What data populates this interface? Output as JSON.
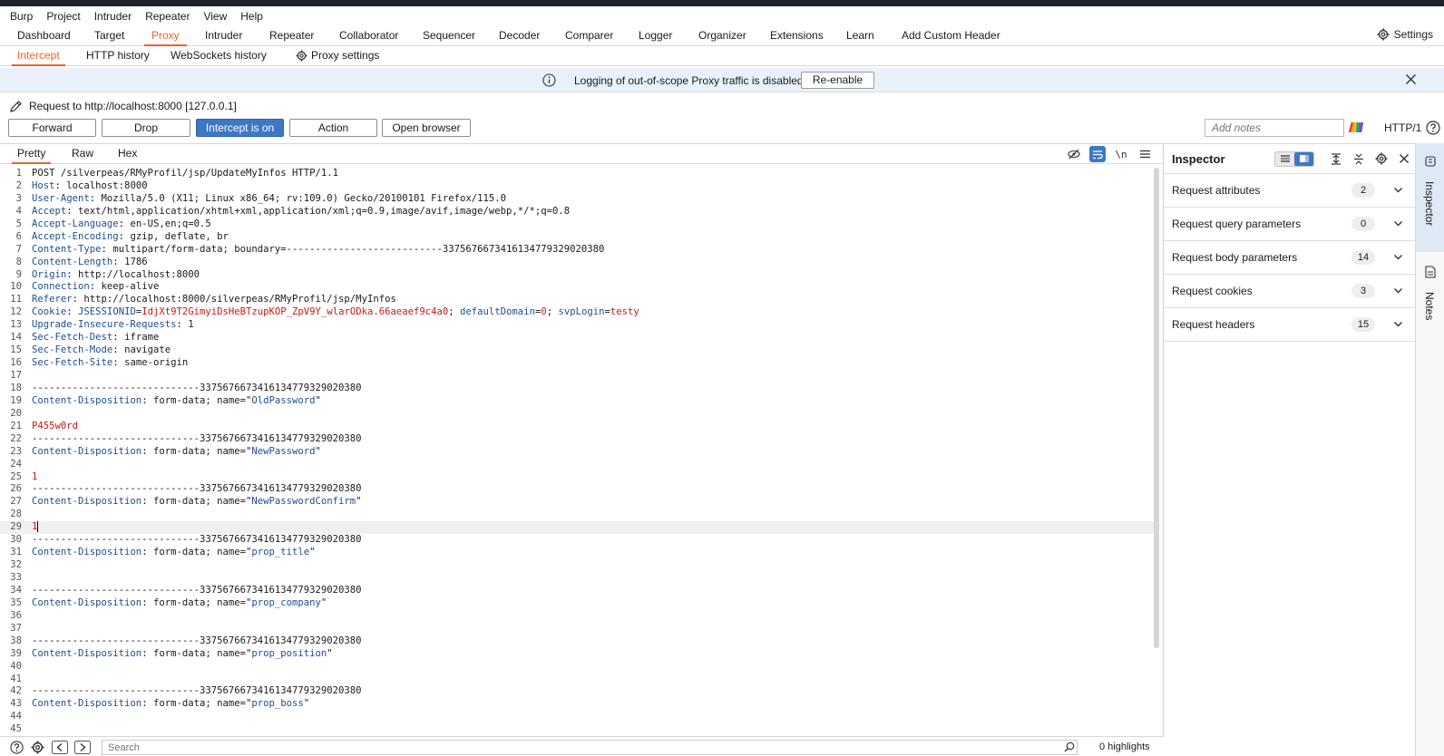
{
  "menu": [
    "Burp",
    "Project",
    "Intruder",
    "Repeater",
    "View",
    "Help"
  ],
  "tabs": [
    "Dashboard",
    "Target",
    "Proxy",
    "Intruder",
    "Repeater",
    "Collaborator",
    "Sequencer",
    "Decoder",
    "Comparer",
    "Logger",
    "Organizer",
    "Extensions",
    "Learn",
    "Add Custom Header"
  ],
  "settings_label": "Settings",
  "subtabs": [
    "Intercept",
    "HTTP history",
    "WebSockets history",
    "Proxy settings"
  ],
  "banner": {
    "message": "Logging of out-of-scope Proxy traffic is disabled",
    "button": "Re-enable"
  },
  "request_target": "Request to http://localhost:8000  [127.0.0.1]",
  "buttons": [
    "Forward",
    "Drop",
    "Intercept is on",
    "Action",
    "Open browser"
  ],
  "notes_placeholder": "Add notes",
  "http_version": "HTTP/1",
  "editor_tabs": [
    "Pretty",
    "Raw",
    "Hex"
  ],
  "request_lines": [
    {
      "n": "1",
      "k": "",
      "v": "POST /silverpeas/RMyProfil/jsp/UpdateMyInfos HTTP/1.1"
    },
    {
      "n": "2",
      "k": "Host",
      "v": "localhost:8000"
    },
    {
      "n": "3",
      "k": "User-Agent",
      "v": "Mozilla/5.0 (X11; Linux x86_64; rv:109.0) Gecko/20100101 Firefox/115.0"
    },
    {
      "n": "4",
      "k": "Accept",
      "v": "text/html,application/xhtml+xml,application/xml;q=0.9,image/avif,image/webp,*/*;q=0.8"
    },
    {
      "n": "5",
      "k": "Accept-Language",
      "v": "en-US,en;q=0.5"
    },
    {
      "n": "6",
      "k": "Accept-Encoding",
      "v": "gzip, deflate, br"
    },
    {
      "n": "7",
      "k": "Content-Type",
      "v": "multipart/form-data; boundary=---------------------------3375676673416134779329020380"
    },
    {
      "n": "8",
      "k": "Content-Length",
      "v": "1786"
    },
    {
      "n": "9",
      "k": "Origin",
      "v": "http://localhost:8000"
    },
    {
      "n": "10",
      "k": "Connection",
      "v": "keep-alive"
    },
    {
      "n": "11",
      "k": "Referer",
      "v": "http://localhost:8000/silverpeas/RMyProfil/jsp/MyInfos"
    },
    {
      "n": "12",
      "cookie": true,
      "k": "Cookie",
      "c1k": "JSESSIONID",
      "c1v": "IdjXt9T2GimyiDsHeBTzupKOP_ZpV9Y_wlarODka.66aeaef9c4a0",
      "c2k": "defaultDomain",
      "c2v": "0",
      "c3k": "svpLogin",
      "c3v": "testy"
    },
    {
      "n": "13",
      "k": "Upgrade-Insecure-Requests",
      "v": "1"
    },
    {
      "n": "14",
      "k": "Sec-Fetch-Dest",
      "v": "iframe"
    },
    {
      "n": "15",
      "k": "Sec-Fetch-Mode",
      "v": "navigate"
    },
    {
      "n": "16",
      "k": "Sec-Fetch-Site",
      "v": "same-origin"
    },
    {
      "n": "17",
      "k": "",
      "v": ""
    },
    {
      "n": "18",
      "k": "",
      "v": "-----------------------------3375676673416134779329020380"
    },
    {
      "n": "19",
      "disp": "OldPassword"
    },
    {
      "n": "20",
      "k": "",
      "v": ""
    },
    {
      "n": "21",
      "val": "P455w0rd"
    },
    {
      "n": "22",
      "k": "",
      "v": "-----------------------------3375676673416134779329020380"
    },
    {
      "n": "23",
      "disp": "NewPassword"
    },
    {
      "n": "24",
      "k": "",
      "v": ""
    },
    {
      "n": "25",
      "val": "1"
    },
    {
      "n": "26",
      "k": "",
      "v": "-----------------------------3375676673416134779329020380"
    },
    {
      "n": "27",
      "disp": "NewPasswordConfirm"
    },
    {
      "n": "28",
      "k": "",
      "v": ""
    },
    {
      "n": "29",
      "val": "1",
      "cur": true
    },
    {
      "n": "30",
      "k": "",
      "v": "-----------------------------3375676673416134779329020380"
    },
    {
      "n": "31",
      "disp": "prop_title"
    },
    {
      "n": "32",
      "k": "",
      "v": ""
    },
    {
      "n": "33",
      "k": "",
      "v": ""
    },
    {
      "n": "34",
      "k": "",
      "v": "-----------------------------3375676673416134779329020380"
    },
    {
      "n": "35",
      "disp": "prop_company"
    },
    {
      "n": "36",
      "k": "",
      "v": ""
    },
    {
      "n": "37",
      "k": "",
      "v": ""
    },
    {
      "n": "38",
      "k": "",
      "v": "-----------------------------3375676673416134779329020380"
    },
    {
      "n": "39",
      "disp": "prop_position"
    },
    {
      "n": "40",
      "k": "",
      "v": ""
    },
    {
      "n": "41",
      "k": "",
      "v": ""
    },
    {
      "n": "42",
      "k": "",
      "v": "-----------------------------3375676673416134779329020380"
    },
    {
      "n": "43",
      "disp": "prop_boss"
    },
    {
      "n": "44",
      "k": "",
      "v": ""
    },
    {
      "n": "45",
      "k": "",
      "v": ""
    }
  ],
  "search_placeholder": "Search",
  "highlights": "0 highlights",
  "inspector": {
    "title": "Inspector",
    "sections": [
      {
        "label": "Request attributes",
        "count": "2"
      },
      {
        "label": "Request query parameters",
        "count": "0"
      },
      {
        "label": "Request body parameters",
        "count": "14"
      },
      {
        "label": "Request cookies",
        "count": "3"
      },
      {
        "label": "Request headers",
        "count": "15"
      }
    ]
  },
  "rail": [
    "Inspector",
    "Notes"
  ],
  "colors": {
    "accent": "#e8642c",
    "primary_button": "#3d78c7",
    "header_key": "#1f4d8f",
    "value_red": "#c41a16"
  }
}
